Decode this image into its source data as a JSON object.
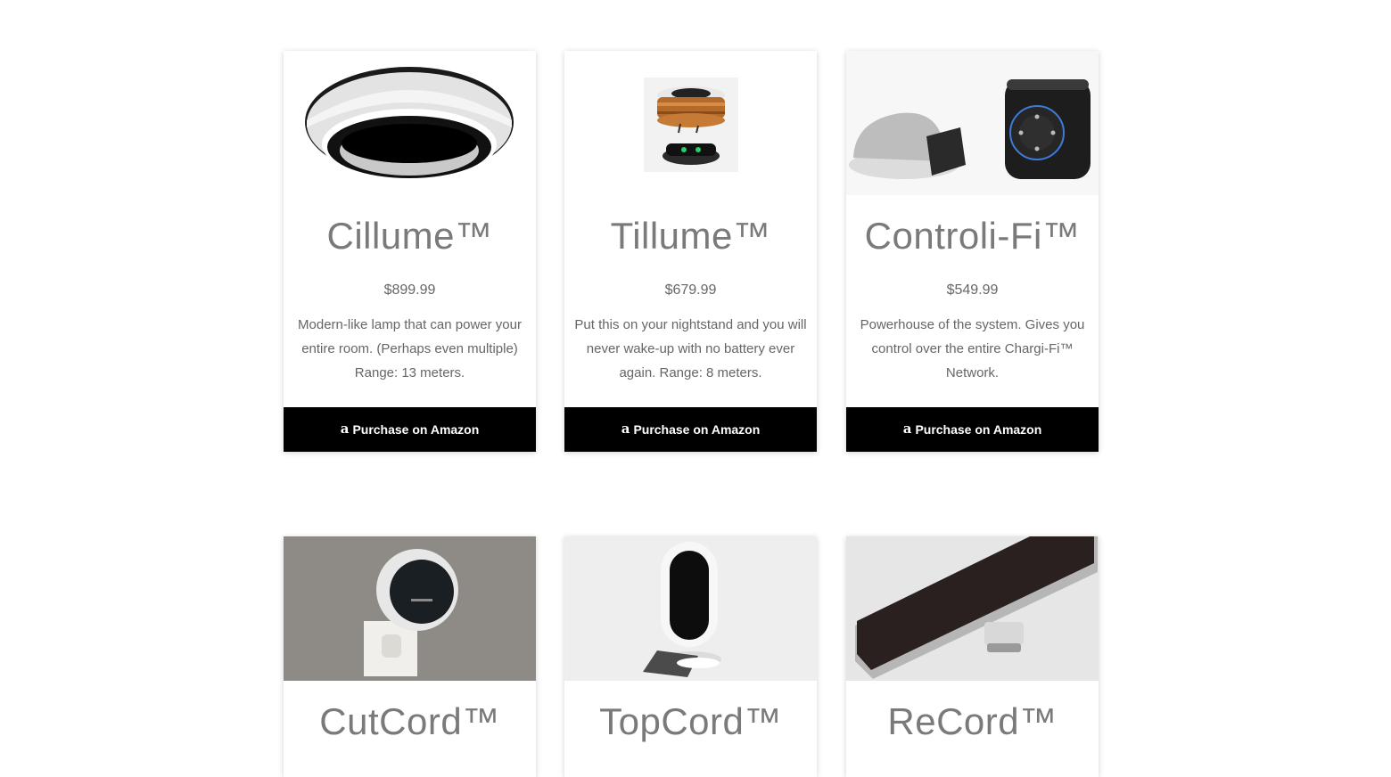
{
  "buy_label": "Purchase on Amazon",
  "buy_icon": "a",
  "products": [
    {
      "name": "Cillume™",
      "price": "$899.99",
      "description": "Modern-like lamp that can power your entire room. (Perhaps even multiple) Range: 13 meters.",
      "image": "white-ring-lamp"
    },
    {
      "name": "Tillume™",
      "price": "$679.99",
      "description": "Put this on your nightstand and you will never wake-up with no battery ever again. Range: 8 meters.",
      "image": "wood-levitating-lamp"
    },
    {
      "name": "Controli-Fi™",
      "price": "$549.99",
      "description": "Powerhouse of the system. Gives you control over the entire Chargi-Fi™ Network.",
      "image": "smart-speaker-hub"
    },
    {
      "name": "CutCord™",
      "image": "wall-plug-charger"
    },
    {
      "name": "TopCord™",
      "image": "camera-stand-charger"
    },
    {
      "name": "ReCord™",
      "image": "usb-c-adapter"
    }
  ]
}
